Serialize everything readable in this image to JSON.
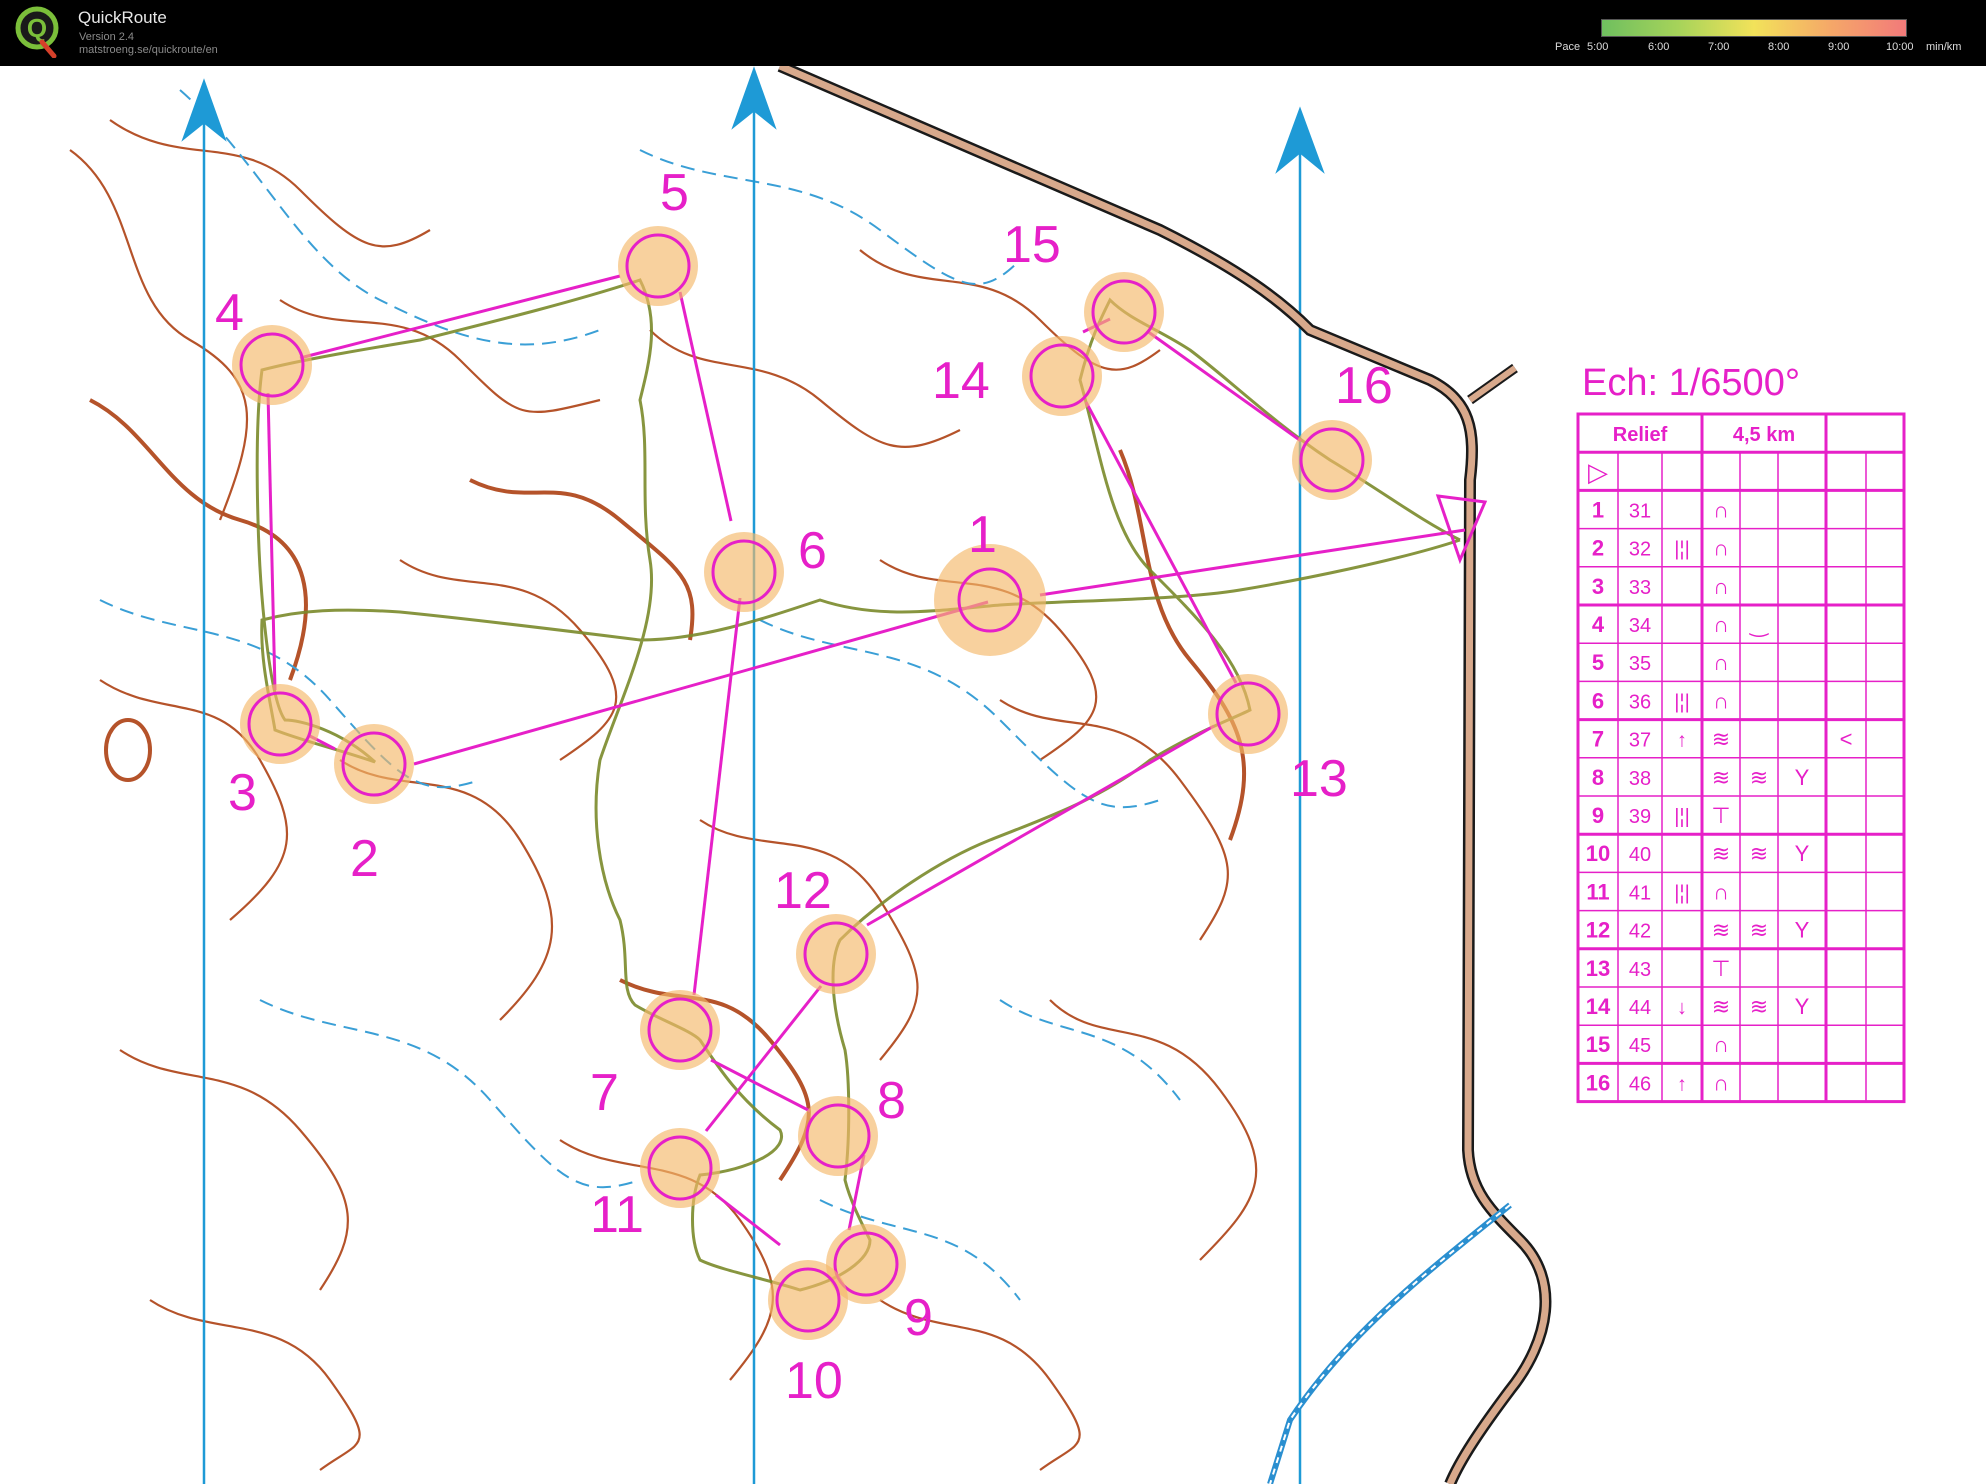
{
  "app": {
    "title": "QuickRoute",
    "version": "Version 2.4",
    "url": "matstroeng.se/quickroute/en",
    "logo_letter": "Q"
  },
  "pace_legend": {
    "label": "Pace",
    "ticks": [
      "5:00",
      "6:00",
      "7:00",
      "8:00",
      "9:00",
      "10:00"
    ],
    "unit": "min/km",
    "colors": [
      "#6fbf5f",
      "#a6d35a",
      "#f2e25a",
      "#f5a868",
      "#f27a7a"
    ]
  },
  "map": {
    "scale_label": "Ech: 1/6500°",
    "colors": {
      "course": "#e620c8",
      "contour": "#b5532a",
      "water": "#3a9fd6",
      "north_line": "#1e9ad6",
      "route": "#7a8a2a"
    },
    "controls": [
      {
        "number": "1"
      },
      {
        "number": "2"
      },
      {
        "number": "3"
      },
      {
        "number": "4"
      },
      {
        "number": "5"
      },
      {
        "number": "6"
      },
      {
        "number": "7"
      },
      {
        "number": "8"
      },
      {
        "number": "9"
      },
      {
        "number": "10"
      },
      {
        "number": "11"
      },
      {
        "number": "12"
      },
      {
        "number": "13"
      },
      {
        "number": "14"
      },
      {
        "number": "15"
      },
      {
        "number": "16"
      }
    ],
    "description_table": {
      "header_left": "Relief",
      "header_right": "4,5 km",
      "start_symbol": "▷",
      "rows": [
        {
          "num": "1",
          "code": "31",
          "col_c": "",
          "col_d": "∩",
          "col_e": "",
          "col_g": ""
        },
        {
          "num": "2",
          "code": "32",
          "col_c": "|¦|",
          "col_d": "∩",
          "col_e": "",
          "col_g": ""
        },
        {
          "num": "3",
          "code": "33",
          "col_c": "",
          "col_d": "∩",
          "col_e": "",
          "col_g": ""
        },
        {
          "num": "4",
          "code": "34",
          "col_c": "",
          "col_d": "∩",
          "col_e": "‿",
          "col_g": ""
        },
        {
          "num": "5",
          "code": "35",
          "col_c": "",
          "col_d": "∩",
          "col_e": "",
          "col_g": ""
        },
        {
          "num": "6",
          "code": "36",
          "col_c": "|¦|",
          "col_d": "∩",
          "col_e": "",
          "col_g": ""
        },
        {
          "num": "7",
          "code": "37",
          "col_c": "↑",
          "col_d": "≋",
          "col_e": "",
          "col_g": "<"
        },
        {
          "num": "8",
          "code": "38",
          "col_c": "",
          "col_d": "≋",
          "col_e": "≋",
          "col_f": "Y",
          "col_g": ""
        },
        {
          "num": "9",
          "code": "39",
          "col_c": "|¦|",
          "col_d": "⊤",
          "col_e": "",
          "col_g": ""
        },
        {
          "num": "10",
          "code": "40",
          "col_c": "",
          "col_d": "≋",
          "col_e": "≋",
          "col_f": "Y",
          "col_g": ""
        },
        {
          "num": "11",
          "code": "41",
          "col_c": "|¦|",
          "col_d": "∩",
          "col_e": "",
          "col_g": ""
        },
        {
          "num": "12",
          "code": "42",
          "col_c": "",
          "col_d": "≋",
          "col_e": "≋",
          "col_f": "Y",
          "col_g": ""
        },
        {
          "num": "13",
          "code": "43",
          "col_c": "",
          "col_d": "⊤",
          "col_e": "",
          "col_g": ""
        },
        {
          "num": "14",
          "code": "44",
          "col_c": "↓",
          "col_d": "≋",
          "col_e": "≋",
          "col_f": "Y",
          "col_g": ""
        },
        {
          "num": "15",
          "code": "45",
          "col_c": "",
          "col_d": "∩",
          "col_e": "",
          "col_g": ""
        },
        {
          "num": "16",
          "code": "46",
          "col_c": "↑",
          "col_d": "∩",
          "col_e": "",
          "col_g": ""
        }
      ]
    }
  }
}
